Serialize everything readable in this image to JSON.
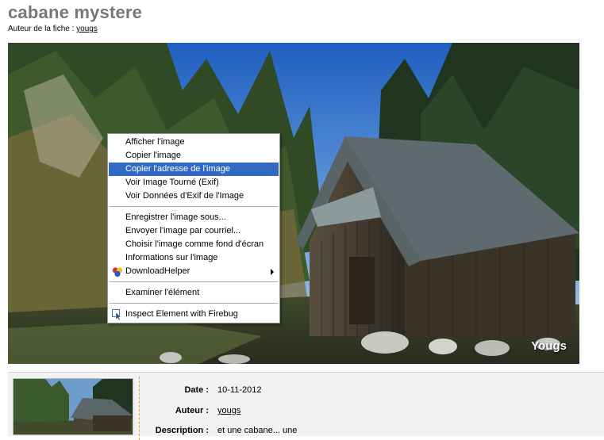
{
  "header": {
    "title": "cabane mystere",
    "author_prefix": "Auteur de la fiche : ",
    "author_name": "yougs"
  },
  "photo": {
    "watermark": "Yougs"
  },
  "context_menu": {
    "group1": [
      "Afficher l'image",
      "Copier l'image",
      "Copier l'adresse de l'image",
      "Voir Image Tourné (Exif)",
      "Voir Données d'Exif de l'Image"
    ],
    "group2": [
      "Enregistrer l'image sous...",
      "Envoyer l'image par courriel...",
      "Choisir l'image comme fond d'écran",
      "Informations sur l'image",
      "DownloadHelper"
    ],
    "group3": [
      "Examiner l'élément"
    ],
    "group4": [
      "Inspect Element with Firebug"
    ],
    "highlighted": "Copier l'adresse de l'image"
  },
  "details": {
    "date_label": "Date :",
    "date_value": "10-11-2012",
    "author_label": "Auteur :",
    "author_value": "yougs",
    "description_label": "Description :",
    "description_value": "et une cabane... une"
  }
}
